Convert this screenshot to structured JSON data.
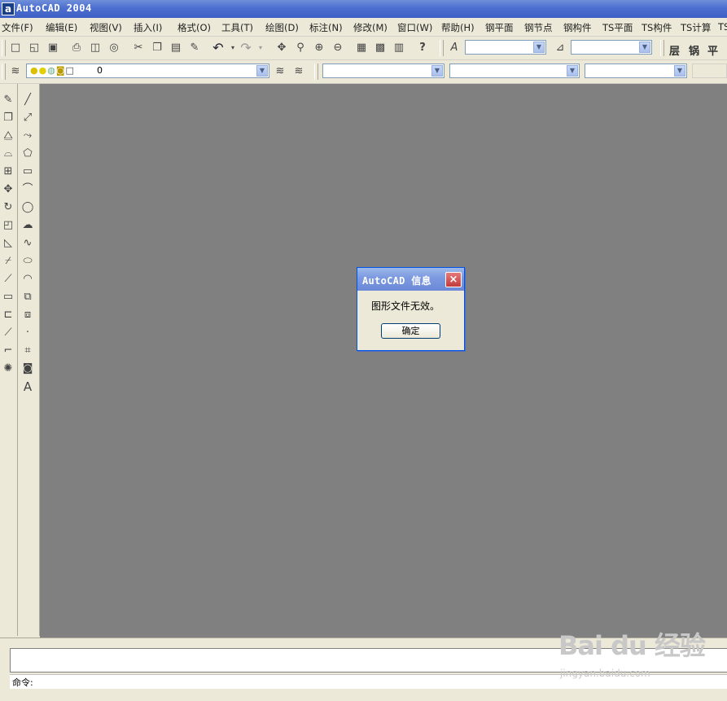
{
  "window": {
    "title": "AutoCAD 2004",
    "icon": "autocad-app-icon",
    "icon_glyph": "a"
  },
  "menu": {
    "items": [
      "文件(F)",
      "编辑(E)",
      "视图(V)",
      "插入(I)",
      "格式(O)",
      "工具(T)",
      "绘图(D)",
      "标注(N)",
      "修改(M)",
      "窗口(W)",
      "帮助(H)",
      "钢平面",
      "钢节点",
      "钢构件",
      "TS平面",
      "TS构件",
      "TS计算",
      "TS"
    ]
  },
  "toolbar": {
    "tools": [
      "new-icon",
      "open-icon",
      "save-icon",
      "print-icon",
      "preview-icon",
      "publish-icon",
      "cut-icon",
      "copy-icon",
      "paste-icon",
      "match-icon",
      "undo-icon",
      "redo-icon",
      "pan-icon",
      "zoom-realtime-icon",
      "zoom-window-icon",
      "zoom-previous-icon",
      "properties-icon",
      "design-center-icon",
      "tool-palettes-icon",
      "help-icon",
      "text-style-icon",
      "dim-style-icon"
    ],
    "ts_buttons": [
      "层",
      "锅",
      "平"
    ],
    "text_style_value": "",
    "dim_style_value": ""
  },
  "layers": {
    "current_layer": "0"
  },
  "properties": {
    "color": "",
    "linetype": "",
    "lineweight": "",
    "plotstyle": ""
  },
  "dialog": {
    "title": "AutoCAD 信息",
    "message": "图形文件无效。",
    "ok_label": "确定",
    "close_glyph": "×"
  },
  "command": {
    "prompt": "命令:",
    "history": ""
  },
  "watermark": {
    "main": "Bai du 经验",
    "sub": "jingyan.baidu.com"
  },
  "colors": {
    "titlebar": "#3e60c6",
    "drawing_bg": "#808080",
    "chrome": "#ece9d8",
    "close_button": "#c33b3b"
  }
}
